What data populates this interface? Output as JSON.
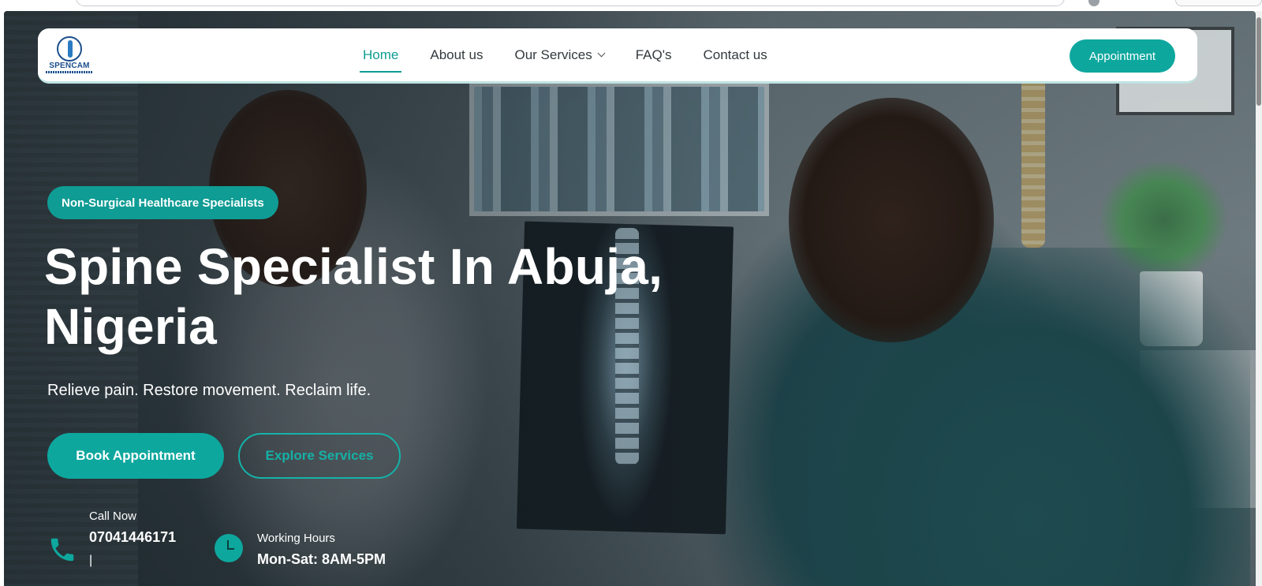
{
  "nav": {
    "logo_text": "SPENCAM",
    "links": [
      {
        "label": "Home",
        "active": true
      },
      {
        "label": "About us"
      },
      {
        "label": "Our Services",
        "has_dropdown": true
      },
      {
        "label": "FAQ's"
      },
      {
        "label": "Contact us"
      }
    ],
    "cta_label": "Appointment"
  },
  "hero": {
    "badge": "Non-Surgical Healthcare Specialists",
    "title_line1": "Spine Specialist In Abuja,",
    "title_line2": "Nigeria",
    "subtitle": "Relieve pain. Restore movement. Reclaim life.",
    "primary_button": "Book Appointment",
    "secondary_button": "Explore Services",
    "call": {
      "label": "Call Now",
      "number": "07041446171",
      "separator": "|"
    },
    "hours": {
      "label": "Working Hours",
      "value": "Mon-Sat: 8AM-5PM"
    }
  },
  "colors": {
    "accent": "#0ea79e",
    "nav_text": "#333a3d",
    "white": "#ffffff"
  },
  "icons": [
    "phone-icon",
    "clock-icon",
    "chevron-down-icon",
    "spencam-logo"
  ]
}
